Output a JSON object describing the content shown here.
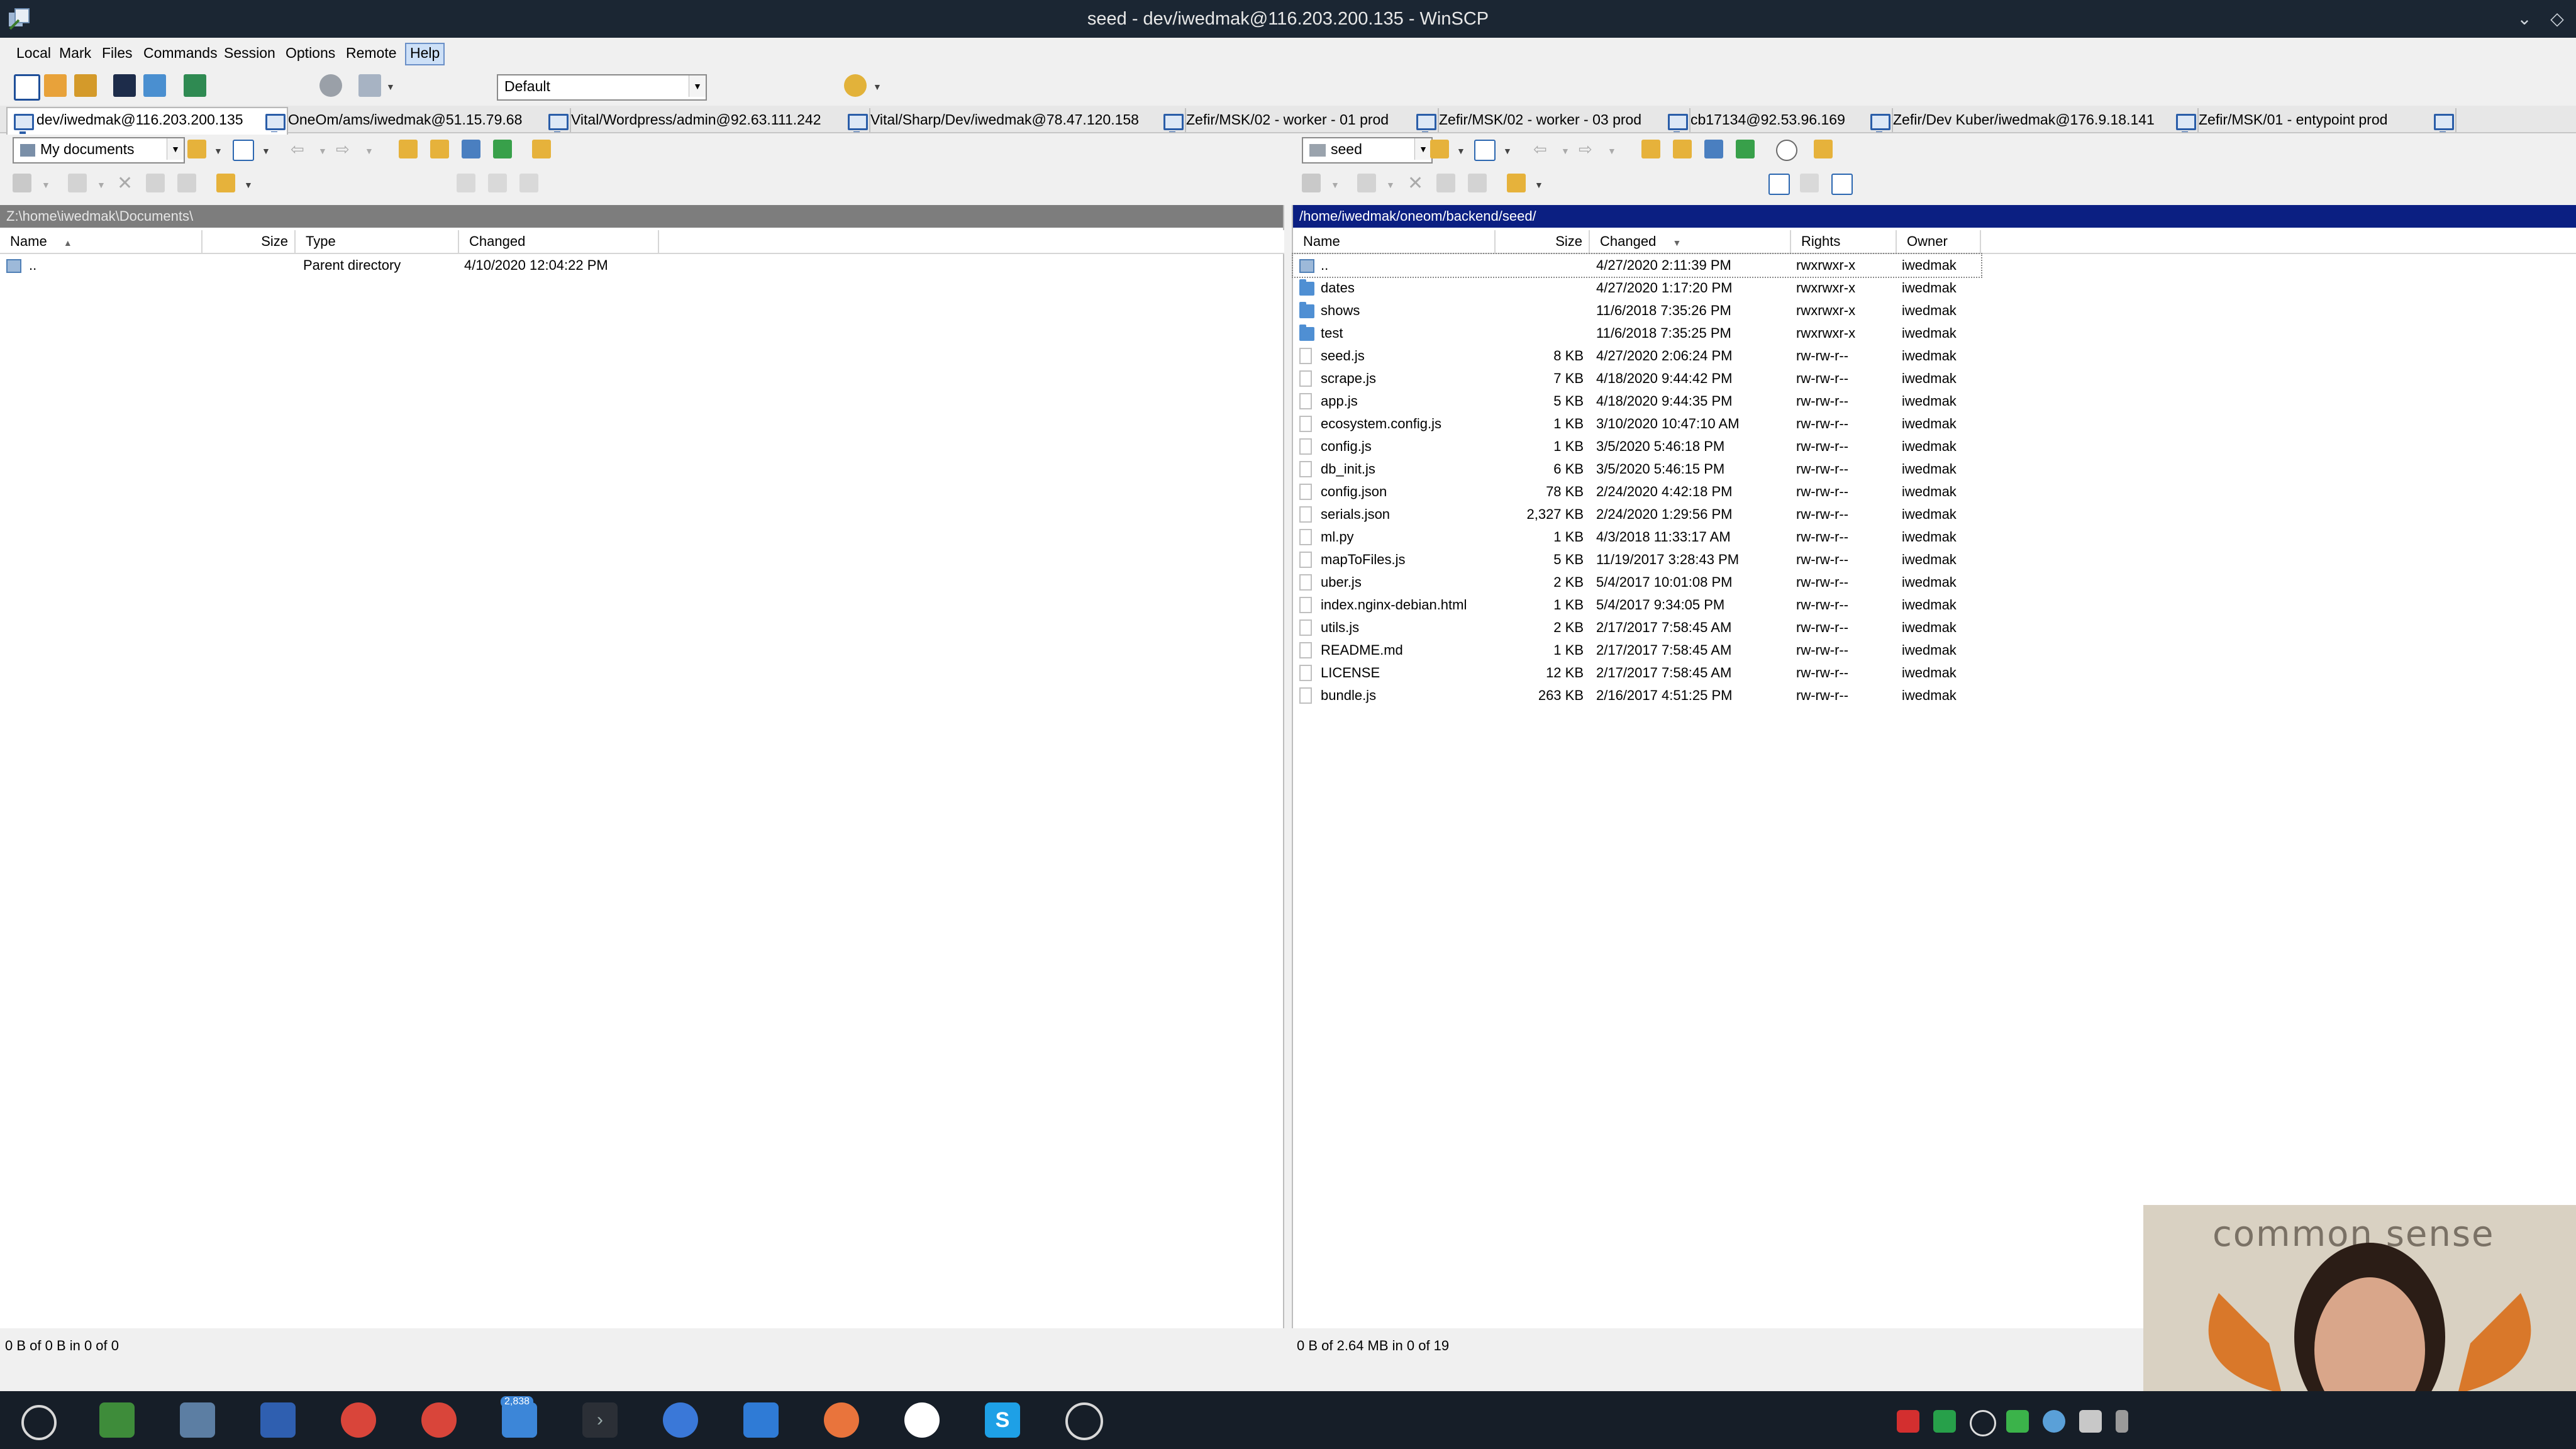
{
  "window": {
    "title": "seed - dev/iwedmak@116.203.200.135 - WinSCP"
  },
  "menu": {
    "items": [
      "Local",
      "Mark",
      "Files",
      "Commands",
      "Session",
      "Options",
      "Remote",
      "Help"
    ]
  },
  "toolbar": {
    "transfer_settings": "Default"
  },
  "session_tabs": [
    "dev/iwedmak@116.203.200.135",
    "OneOm/ams/iwedmak@51.15.79.68",
    "Vital/Wordpress/admin@92.63.111.242",
    "Vital/Sharp/Dev/iwedmak@78.47.120.158",
    "Zefir/MSK/02 - worker - 01 prod",
    "Zefir/MSK/02 - worker - 03 prod",
    "cb17134@92.53.96.169",
    "Zefir/Dev Kuber/iwedmak@176.9.18.141",
    "Zefir/MSK/01 - entypoint prod"
  ],
  "local": {
    "location": "My documents",
    "path": "Z:\\home\\iwedmak\\Documents\\",
    "columns": [
      "Name",
      "Size",
      "Type",
      "Changed"
    ],
    "rows": [
      {
        "name": "..",
        "size": "",
        "type": "Parent directory",
        "changed": "4/10/2020  12:04:22 PM",
        "kind": "up"
      }
    ],
    "status": "0 B of 0 B in 0 of 0"
  },
  "remote": {
    "location": "seed",
    "path": "/home/iwedmak/oneom/backend/seed/",
    "columns": [
      "Name",
      "Size",
      "Changed",
      "Rights",
      "Owner"
    ],
    "rows": [
      {
        "name": "..",
        "size": "",
        "changed": "4/27/2020 2:11:39 PM",
        "rights": "rwxrwxr-x",
        "owner": "iwedmak",
        "kind": "up"
      },
      {
        "name": "dates",
        "size": "",
        "changed": "4/27/2020 1:17:20 PM",
        "rights": "rwxrwxr-x",
        "owner": "iwedmak",
        "kind": "folder"
      },
      {
        "name": "shows",
        "size": "",
        "changed": "11/6/2018 7:35:26 PM",
        "rights": "rwxrwxr-x",
        "owner": "iwedmak",
        "kind": "folder"
      },
      {
        "name": "test",
        "size": "",
        "changed": "11/6/2018 7:35:25 PM",
        "rights": "rwxrwxr-x",
        "owner": "iwedmak",
        "kind": "folder"
      },
      {
        "name": "seed.js",
        "size": "8 KB",
        "changed": "4/27/2020 2:06:24 PM",
        "rights": "rw-rw-r--",
        "owner": "iwedmak",
        "kind": "file"
      },
      {
        "name": "scrape.js",
        "size": "7 KB",
        "changed": "4/18/2020 9:44:42 PM",
        "rights": "rw-rw-r--",
        "owner": "iwedmak",
        "kind": "file"
      },
      {
        "name": "app.js",
        "size": "5 KB",
        "changed": "4/18/2020 9:44:35 PM",
        "rights": "rw-rw-r--",
        "owner": "iwedmak",
        "kind": "file"
      },
      {
        "name": "ecosystem.config.js",
        "size": "1 KB",
        "changed": "3/10/2020 10:47:10 AM",
        "rights": "rw-rw-r--",
        "owner": "iwedmak",
        "kind": "file"
      },
      {
        "name": "config.js",
        "size": "1 KB",
        "changed": "3/5/2020 5:46:18 PM",
        "rights": "rw-rw-r--",
        "owner": "iwedmak",
        "kind": "file"
      },
      {
        "name": "db_init.js",
        "size": "6 KB",
        "changed": "3/5/2020 5:46:15 PM",
        "rights": "rw-rw-r--",
        "owner": "iwedmak",
        "kind": "file"
      },
      {
        "name": "config.json",
        "size": "78 KB",
        "changed": "2/24/2020 4:42:18 PM",
        "rights": "rw-rw-r--",
        "owner": "iwedmak",
        "kind": "file"
      },
      {
        "name": "serials.json",
        "size": "2,327 KB",
        "changed": "2/24/2020 1:29:56 PM",
        "rights": "rw-rw-r--",
        "owner": "iwedmak",
        "kind": "file"
      },
      {
        "name": "ml.py",
        "size": "1 KB",
        "changed": "4/3/2018 11:33:17 AM",
        "rights": "rw-rw-r--",
        "owner": "iwedmak",
        "kind": "file"
      },
      {
        "name": "mapToFiles.js",
        "size": "5 KB",
        "changed": "11/19/2017 3:28:43 PM",
        "rights": "rw-rw-r--",
        "owner": "iwedmak",
        "kind": "file"
      },
      {
        "name": "uber.js",
        "size": "2 KB",
        "changed": "5/4/2017 10:01:08 PM",
        "rights": "rw-rw-r--",
        "owner": "iwedmak",
        "kind": "file"
      },
      {
        "name": "index.nginx-debian.html",
        "size": "1 KB",
        "changed": "5/4/2017 9:34:05 PM",
        "rights": "rw-rw-r--",
        "owner": "iwedmak",
        "kind": "file"
      },
      {
        "name": "utils.js",
        "size": "2 KB",
        "changed": "2/17/2017 7:58:45 AM",
        "rights": "rw-rw-r--",
        "owner": "iwedmak",
        "kind": "file"
      },
      {
        "name": "README.md",
        "size": "1 KB",
        "changed": "2/17/2017 7:58:45 AM",
        "rights": "rw-rw-r--",
        "owner": "iwedmak",
        "kind": "file"
      },
      {
        "name": "LICENSE",
        "size": "12 KB",
        "changed": "2/17/2017 7:58:45 AM",
        "rights": "rw-rw-r--",
        "owner": "iwedmak",
        "kind": "file"
      },
      {
        "name": "bundle.js",
        "size": "263 KB",
        "changed": "2/16/2017 4:51:25 PM",
        "rights": "rw-rw-r--",
        "owner": "iwedmak",
        "kind": "file"
      }
    ],
    "status": "0 B of 2.64 MB in 0 of 19"
  },
  "taskbar": {
    "badge": "2,838",
    "apps": [
      "start-circle-icon",
      "notepad-icon",
      "winscp-icon",
      "network-icon",
      "chrome-icon",
      "chrome-icon",
      "mail-icon",
      "terminal-icon",
      "qbittorrent-icon",
      "file-manager-icon",
      "sublime-icon",
      "mongodb-icon",
      "skype-icon",
      "obs-icon"
    ]
  },
  "overlay": {
    "brand": "common  sense"
  },
  "colors": {
    "remote_path_bar": "#0b1f82",
    "local_path_bar": "#7d7d7d",
    "taskbar": "#161e28",
    "title": "#1b2633"
  }
}
